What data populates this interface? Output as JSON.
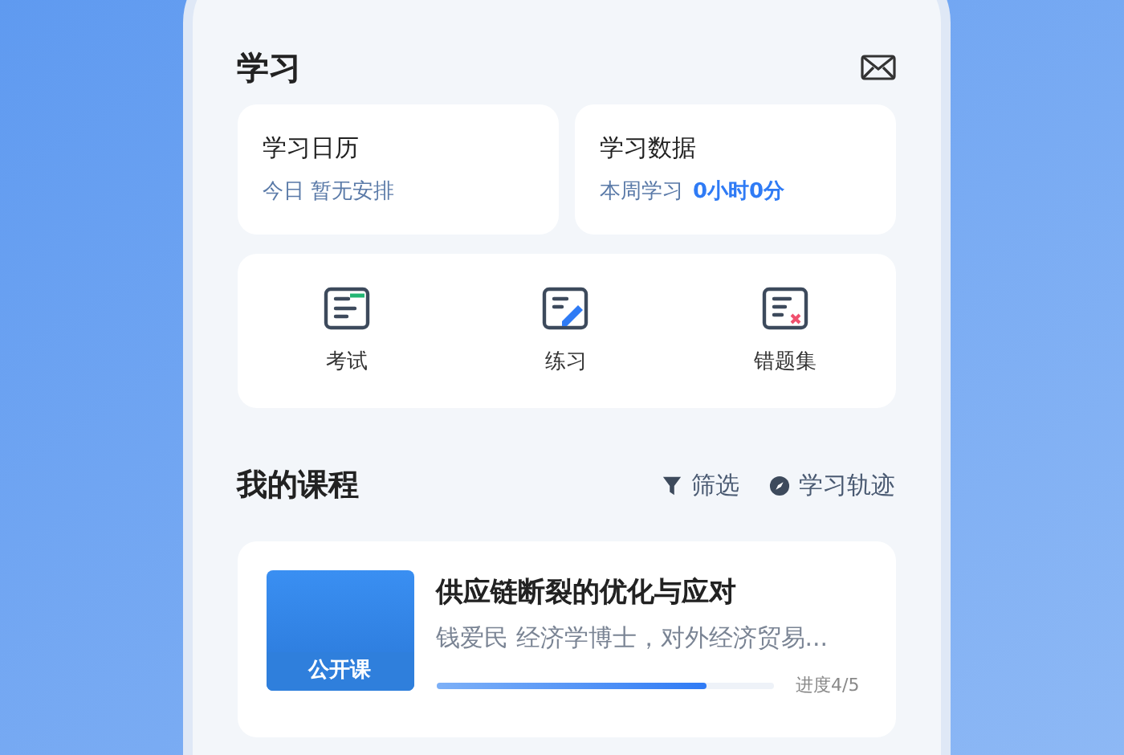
{
  "header": {
    "title": "学习"
  },
  "summary_cards": [
    {
      "title": "学习日历",
      "label": "今日 暂无安排"
    },
    {
      "title": "学习数据",
      "label": "本周学习",
      "value": "0小时0分"
    }
  ],
  "shortcuts": [
    {
      "kind": "exam",
      "label": "考试"
    },
    {
      "kind": "practice",
      "label": "练习"
    },
    {
      "kind": "mistakes",
      "label": "错题集"
    }
  ],
  "courses_section": {
    "title": "我的课程",
    "actions": [
      {
        "kind": "filter",
        "label": "筛选"
      },
      {
        "kind": "history",
        "label": "学习轨迹"
      }
    ]
  },
  "courses": [
    {
      "badge": "公开课",
      "title": "供应链断裂的优化与应对",
      "subtitle": "钱爱民 经济学博士，对外经济贸易...",
      "level": 0.8,
      "progress": "进度4/5"
    }
  ]
}
